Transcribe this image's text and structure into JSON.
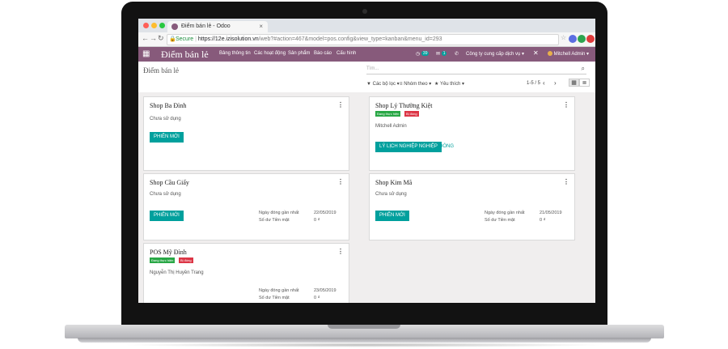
{
  "browser": {
    "tab_title": "Điểm bán lẻ - Odoo",
    "secure_label": "Secure",
    "url_host": "https://12e.izisolution.vn",
    "url_path": "/web?#action=467&model=pos.config&view_type=kanban&menu_id=293"
  },
  "navbar": {
    "brand": "Điểm bán lẻ",
    "menu_items": [
      "Bảng thông tin",
      "Các hoạt động",
      "Sản phẩm",
      "Báo cáo",
      "Cấu hình"
    ],
    "activity_count": "39",
    "message_count": "1",
    "company": "Công ty cung cấp dịch vụ",
    "user": "Mitchell Admin"
  },
  "control_panel": {
    "breadcrumb": "Điểm bán lẻ",
    "search_placeholder": "Tìm...",
    "filters_label": "Các bộ lọc",
    "group_by_label": "Nhóm theo",
    "favorites_label": "Yêu thích",
    "pager": "1-5 / 5"
  },
  "cards": {
    "ba_dinh": {
      "title": "Shop Ba Đình",
      "status": "Chưa sử dụng",
      "button": "PHIÊN MỚI"
    },
    "ly_thuong_kiet": {
      "title": "Shop Lý Thường Kiệt",
      "tag_in_progress": "Đang thực hiện",
      "tag_locked": "Bị đóng",
      "user": "Mitchell Admin",
      "button": "LÝ LỊCH NGHIỆP NGHIỆP",
      "close_link": "ĐÓNG"
    },
    "cau_giay": {
      "title": "Shop Cầu Giấy",
      "status": "Chưa sử dụng",
      "button": "PHIÊN MỚI",
      "last_closed_label": "Ngày đóng gần nhất",
      "last_closed_value": "22/05/2019",
      "cash_label": "Số dư Tiền mặt",
      "cash_value": "0 ₫"
    },
    "kim_ma": {
      "title": "Shop Kim Mã",
      "status": "Chưa sử dụng",
      "button": "PHIÊN MỚI",
      "last_closed_label": "Ngày đóng gần nhất",
      "last_closed_value": "21/05/2019",
      "cash_label": "Số dư Tiền mặt",
      "cash_value": "0 ₫"
    },
    "my_dinh": {
      "title": "POS Mỹ Đình",
      "tag_in_progress": "Đang thực hiện",
      "tag_locked": "Bị đóng",
      "user": "Nguyễn Thị Huyền Trang",
      "last_closed_label": "Ngày đóng gần nhất",
      "last_closed_value": "23/05/2019",
      "cash_label": "Số dư Tiền mặt",
      "cash_value": "0 ₫"
    }
  },
  "colors": {
    "brand_purple": "#875a7b",
    "primary_teal": "#00a09d",
    "tag_green": "#28a745",
    "tag_red": "#dc3545"
  },
  "icons": [
    "apps-grid-icon",
    "lock-icon",
    "back-icon",
    "forward-icon",
    "reload-icon",
    "search-icon",
    "chevron-left-icon",
    "chevron-right-icon",
    "kanban-view-icon",
    "list-view-icon",
    "kebab-menu-icon",
    "close-icon",
    "filter-icon",
    "group-icon",
    "star-icon"
  ]
}
